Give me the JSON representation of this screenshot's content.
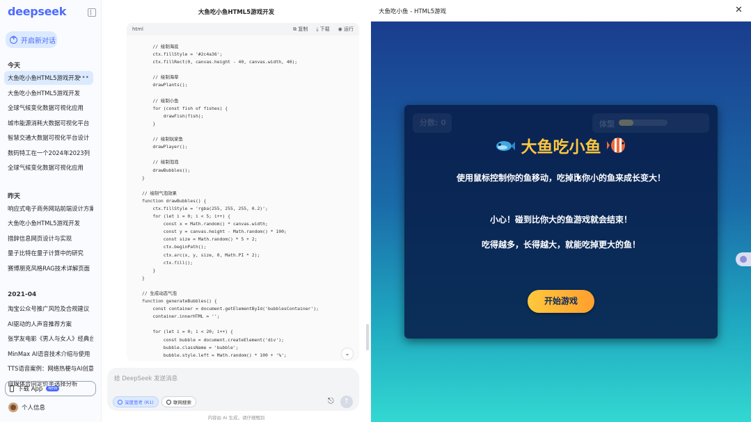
{
  "sidebar": {
    "logo": "deepseek",
    "new_chat_label": "开启新对话",
    "groups": [
      {
        "label": "今天",
        "items": [
          "大鱼吃小鱼HTML5游戏开发",
          "大鱼吃小鱼HTML5游戏开发",
          "全球气候变化数据可视化应用",
          "城市能源消耗大数据可视化平台",
          "智慧交通大数据可视化平台设计",
          "数码特工在一个2024年2023列",
          "全球气候变化数据可视化应用"
        ]
      },
      {
        "label": "昨天",
        "items": [
          "响应式电子商务网站前端设计方案",
          "大鱼吃小鱼HTML5游戏开发",
          "措辞信息网页设计与实现",
          "量子比特在量子计算中的研究",
          "赛博朋克风格RAG技术详解页面"
        ]
      },
      {
        "label": "2021-04",
        "items": [
          "淘宝公众号推广风险及合规建议",
          "AI驱动的人声音推荐方案",
          "张学友电影《男人与女人》经典台词",
          "MinMax AI语音技术介绍与使用",
          "TTS语音案例：网络热梗与AI创意",
          "自媒体合同定价半选择分析"
        ]
      }
    ],
    "download_label": "下载 App",
    "download_badge": "NEW",
    "profile_label": "个人信息"
  },
  "chat": {
    "title": "大鱼吃小鱼HTML5游戏开发",
    "code_lang": "html",
    "copy_label": "复制",
    "download_label": "下载",
    "run_label": "运行",
    "code_lines": [
      "    // 绘制海底",
      "    ctx.fillStyle = '#2c4a36';",
      "    ctx.fillRect(0, canvas.height - 40, canvas.width, 40);",
      "",
      "    // 绘制海草",
      "    drawPlants();",
      "",
      "    // 绘制小鱼",
      "    for (const fish of fishes) {",
      "        drawFish(fish);",
      "    }",
      "",
      "    // 绘制玩家鱼",
      "    drawPlayer();",
      "",
      "    // 绘制泡泡",
      "    drawBubbles();",
      "}",
      "",
      "// 绘制气泡效果",
      "function drawBubbles() {",
      "    ctx.fillStyle = 'rgba(255, 255, 255, 0.2)';",
      "    for (let i = 0; i < 5; i++) {",
      "        const x = Math.random() * canvas.width;",
      "        const y = canvas.height - Math.random() * 100;",
      "        const size = Math.random() * 5 + 2;",
      "        ctx.beginPath();",
      "        ctx.arc(x, y, size, 0, Math.PI * 2);",
      "        ctx.fill();",
      "    }",
      "}",
      "",
      "// 生成动态气泡",
      "function generateBubbles() {",
      "    const container = document.getElementById('bubblesContainer');",
      "    container.innerHTML = '';",
      "",
      "    for (let i = 0; i < 20; i++) {",
      "        const bubble = document.createElement('div');",
      "        bubble.className = 'bubble';",
      "        bubble.style.left = Math.random() * 100 + '%';"
    ],
    "input_placeholder": "给 DeepSeek 发送消息",
    "deep_think_label": "深度思考 (R1)",
    "web_search_label": "联网搜索",
    "footnote": "内容由 AI 生成，请仔细甄别"
  },
  "preview": {
    "title": "大鱼吃小鱼 - HTML5游戏",
    "close_icon": "close-icon",
    "score_label": "分数: 0",
    "size_label": "体型",
    "size_fraction": 0.3,
    "game_title": "大鱼吃小鱼",
    "rules": [
      "使用鼠标控制你的鱼移动，吃掉比你小的鱼来成长变大！",
      "小心！碰到比你大的鱼游戏就会结束！",
      "吃得越多，长得越大，就能吃掉更大的鱼！"
    ],
    "start_label": "开始游戏"
  },
  "colors": {
    "brand": "#4d6bfe",
    "game_title": "#ffc83d",
    "start_button": "#ffb33a",
    "modal_bg": "#0c2a5e"
  }
}
